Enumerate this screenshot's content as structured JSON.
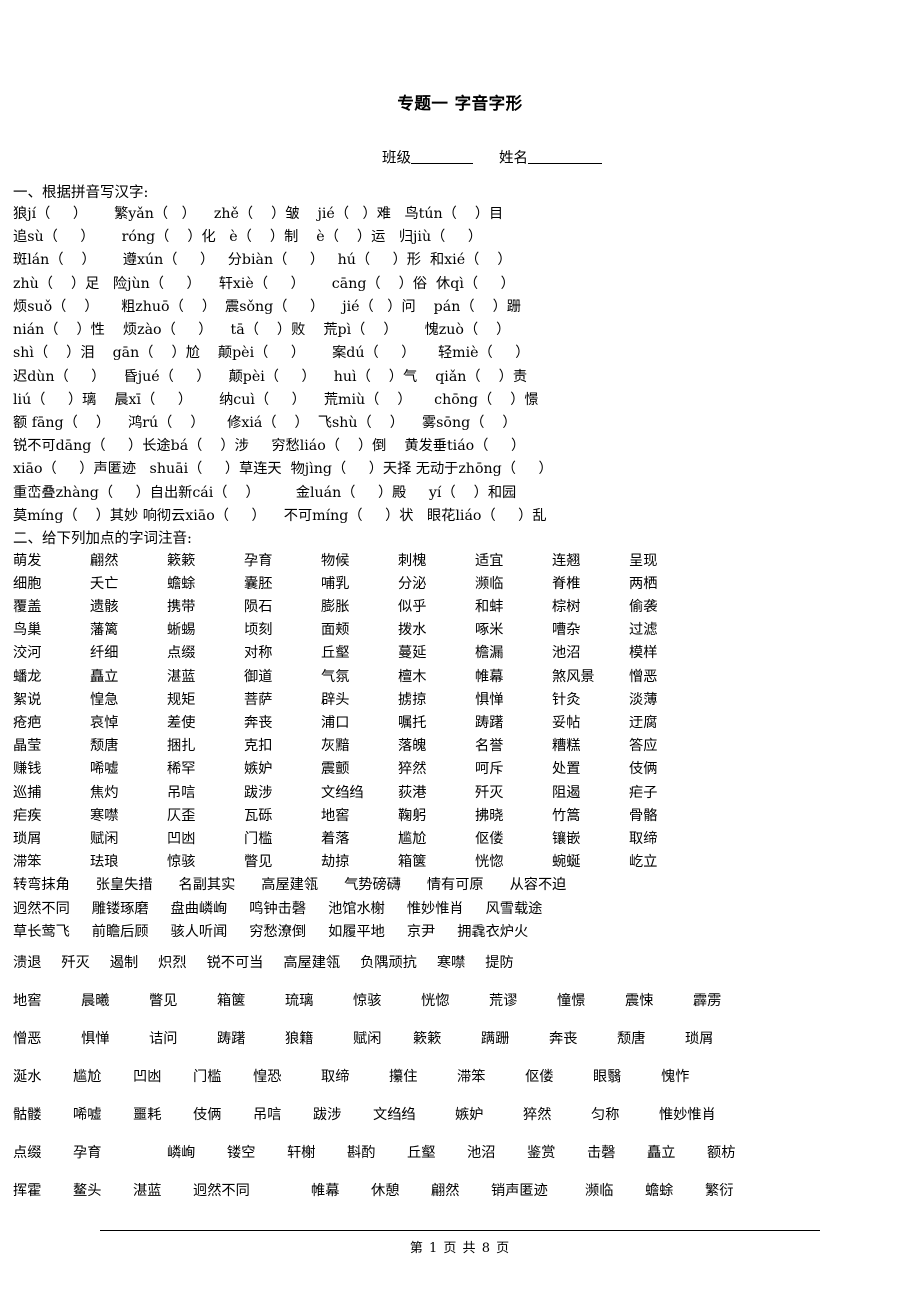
{
  "document": {
    "title": "专题一 字音字形",
    "class_label": "班级",
    "name_label": "姓名"
  },
  "section_one": {
    "heading": "一、根据拼音写汉字:",
    "lines": [
      "狼jí（     ）      繁yǎn（   ）    zhě（    ）皱    jié（   ）难   鸟tún（    ）目",
      "追sù（     ）      róng（    ）化   è（    ）制    è（    ）运   归jiù（     ）",
      "斑lán（    ）      遵xún（     ）   分biàn（     ）   hú（     ）形  和xié（    ）",
      "zhù（    ）足   险jùn（     ）    轩xiè（     ）      cāng（    ）俗  休qì（     ）",
      "烦suǒ（    ）     粗zhuō（    ）  震sǒng（     ）    jié（   ）问    pán（    ）跚",
      "nián（    ）性    烦zào（     ）    tā（    ）败    荒pì（    ）      愧zuò（    ）",
      "shì（    ）泪    gān（    ）尬    颠pèi（     ）      案dú（     ）     轻miè（     ）",
      "迟dùn（     ）    昏jué（     ）    颠pèi（     ）    huì（    ）气    qiǎn（    ）责",
      "liú（     ）璃    晨xī（     ）      纳cuì（     ）    荒miù（    ）     chōng（    ）憬",
      "额 fāng（    ）    鸿rú（    ）     修xiá（    ）  飞shù（    ）    雾sōng（    ）",
      "锐不可dāng（     ）长途bá（    ）涉     穷愁liáo（    ）倒    黄发垂tiáo（     ）",
      "xiāo（     ）声匿迹   shuāi（     ）草连天  物jìng（     ）天择 无动于zhōng（     ）",
      "重峦叠zhàng（     ）自出新cái（    ）        金luán（     ）殿     yí（    ）和园",
      "莫míng（    ）其妙 响彻云xiāo（     ）    不可míng（     ）状   眼花liáo（     ）乱"
    ]
  },
  "section_two": {
    "heading": "二、给下列加点的字词注音:",
    "grid_rows": [
      [
        "萌发",
        "翩然",
        "簌簌",
        "孕育",
        "物候",
        "刺槐",
        "适宜",
        "连翘",
        "呈现"
      ],
      [
        "细胞",
        "夭亡",
        "蟾蜍",
        "囊胚",
        "哺乳",
        "分泌",
        "濒临",
        "脊椎",
        "两栖"
      ],
      [
        "覆盖",
        "遗骸",
        "携带",
        "陨石",
        "膨胀",
        "似乎",
        "和蚌",
        "棕树",
        "偷袭"
      ],
      [
        "鸟巢",
        "藩篱",
        "蜥蜴",
        "顷刻",
        "面颊",
        "拨水",
        "啄米",
        "嘈杂",
        "过滤"
      ],
      [
        "洨河",
        "纤细",
        "点缀",
        "对称",
        "丘壑",
        "蔓延",
        "檐漏",
        "池沼",
        "模样"
      ],
      [
        "蟠龙",
        "矗立",
        "湛蓝",
        "御道",
        "气氛",
        "檀木",
        "帷幕",
        "煞风景",
        "憎恶"
      ],
      [
        "絮说",
        "惶急",
        "规矩",
        "菩萨",
        "辟头",
        "掳掠",
        "惧惮",
        "针灸",
        "淡薄"
      ],
      [
        "疮疤",
        "哀悼",
        "差使",
        "奔丧",
        "浦口",
        "嘱托",
        "踌躇",
        "妥帖",
        "迂腐"
      ],
      [
        "晶莹",
        "颓唐",
        "捆扎",
        "克扣",
        "灰黯",
        "落魄",
        "名誉",
        "糟糕",
        "答应"
      ],
      [
        "赚钱",
        "唏嘘",
        "稀罕",
        "嫉妒",
        "震颤",
        "猝然",
        "呵斥",
        "处置",
        "伎俩"
      ],
      [
        "巡捕",
        "焦灼",
        "吊唁",
        "跋涉",
        "文绉绉",
        "荻港",
        "歼灭",
        "阻遏",
        "疟子"
      ],
      [
        "疟疾",
        "寒噤",
        "仄歪",
        "瓦砾",
        "地窖",
        "鞠躬",
        "拂晓",
        "竹篙",
        "骨骼"
      ],
      [
        "琐屑",
        "赋闲",
        "凹凼",
        "门槛",
        "着落",
        "尴尬",
        "伛偻",
        "镶嵌",
        "取缔"
      ],
      [
        "滞笨",
        "珐琅",
        "惊骇",
        "瞥见",
        "劫掠",
        "箱箧",
        "恍惚",
        "蜿蜒",
        "屹立"
      ]
    ],
    "idiom_rows": [
      [
        "转弯抹角",
        "张皇失措",
        "名副其实",
        "高屋建瓴",
        "气势磅礴",
        "情有可原",
        "从容不迫"
      ],
      [
        "迥然不同",
        "雕镂琢磨",
        "盘曲嶙峋",
        "鸣钟击磬",
        "池馆水榭",
        "惟妙惟肖",
        "风雪载途"
      ],
      [
        "草长莺飞",
        "前瞻后顾",
        "骇人听闻",
        "穷愁潦倒",
        "如履平地",
        "京尹",
        "拥毳衣炉火"
      ]
    ],
    "mixed_row": [
      "溃退",
      "歼灭",
      "遏制",
      "炽烈",
      "锐不可当",
      "高屋建瓴",
      "负隅顽抗",
      "寒噤",
      "提防"
    ],
    "loose_rows": [
      [
        "地窖",
        "晨曦",
        "瞥见",
        "箱箧",
        "琉璃",
        "惊骇",
        "恍惚",
        "荒谬",
        "憧憬",
        "震悚",
        "霹雳"
      ],
      [
        "憎恶",
        "惧惮",
        "诘问",
        "踌躇",
        "狼籍",
        "赋闲",
        "簌簌",
        "蹒跚",
        "奔丧",
        "颓唐",
        "琐屑"
      ],
      [
        "涎水",
        "尴尬",
        "凹凼",
        "门槛",
        "惶恐",
        "取缔",
        "攥住",
        "滞笨",
        "伛偻",
        "眼翳",
        "愧怍"
      ],
      [
        "骷髅",
        "唏嘘",
        "噩耗",
        "伎俩",
        "吊唁",
        "跋涉",
        "文绉绉",
        "嫉妒",
        "猝然",
        "匀称",
        "惟妙惟肖"
      ],
      [
        "点缀",
        "孕育",
        "嶙峋",
        "镂空",
        "轩榭",
        "斟酌",
        "丘壑",
        "池沼",
        "鉴赏",
        "击磬",
        "矗立",
        "额枋"
      ],
      [
        "挥霍",
        "鳌头",
        "湛蓝",
        "迥然不同",
        "帷幕",
        "休憩",
        "翩然",
        "销声匿迹",
        "濒临",
        "蟾蜍",
        "繁衍"
      ]
    ]
  },
  "footer": {
    "text": "第 1 页 共 8 页"
  }
}
